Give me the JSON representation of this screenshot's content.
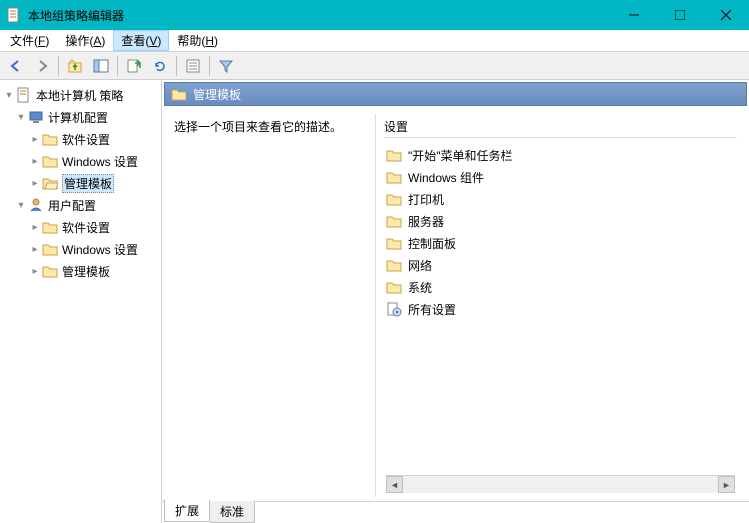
{
  "window": {
    "title": "本地组策略编辑器"
  },
  "menus": {
    "file": "文件(",
    "file_key": "F",
    "file_end": ")",
    "action": "操作(",
    "action_key": "A",
    "action_end": ")",
    "view": "查看(",
    "view_key": "V",
    "view_end": ")",
    "help": "帮助(",
    "help_key": "H",
    "help_end": ")"
  },
  "tree": {
    "root": "本地计算机 策略",
    "computer_config": "计算机配置",
    "cc_software": "软件设置",
    "cc_windows": "Windows 设置",
    "cc_templates": "管理模板",
    "user_config": "用户配置",
    "uc_software": "软件设置",
    "uc_windows": "Windows 设置",
    "uc_templates": "管理模板"
  },
  "content": {
    "header": "管理模板",
    "description": "选择一个项目来查看它的描述。",
    "settings_label": "设置",
    "items": [
      "\"开始\"菜单和任务栏",
      "Windows 组件",
      "打印机",
      "服务器",
      "控制面板",
      "网络",
      "系统",
      "所有设置"
    ]
  },
  "tabs": {
    "extended": "扩展",
    "standard": "标准"
  }
}
